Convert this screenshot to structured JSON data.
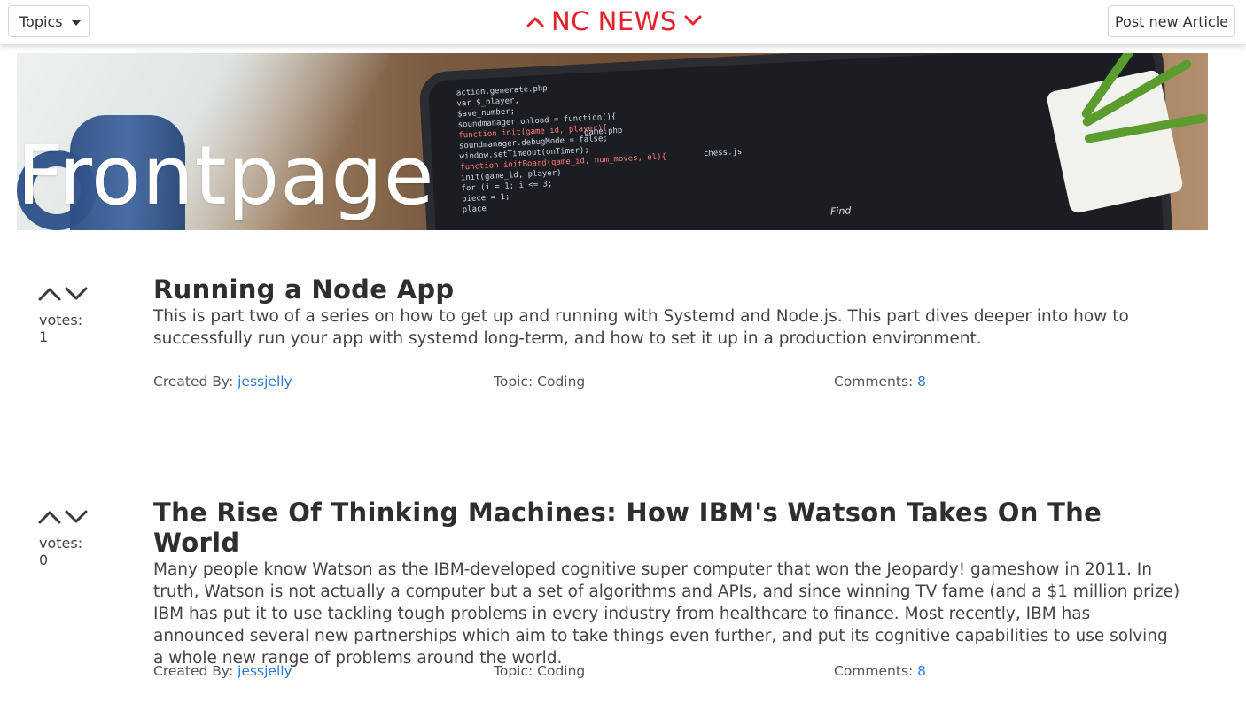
{
  "header": {
    "topics_label": "Topics",
    "brand_title": "NC NEWS",
    "post_label": "Post new Article",
    "brand_color": "#e8202a"
  },
  "hero": {
    "title": "Frontpage",
    "code_lines": [
      "action.generate.php",
      "var $_player,",
      "  $ave_number;",
      "soundmanager.onload = function(){",
      "function init(game_id, player){",
      "  soundmanager.debugMode = false;",
      "  window.setTimeout(onTimer);",
      "function initBoard(game_id, num_moves, el){",
      "  init(game_id, player)",
      "  for (i = 1; i <= 3;",
      "    piece = 1;",
      "place"
    ],
    "tab_labels": [
      "game.php",
      "chess.js"
    ],
    "find_label": "Find"
  },
  "articles": [
    {
      "votes_label": "votes: 1",
      "title": "Running a Node App",
      "body": "This is part two of a series on how to get up and running with Systemd and Node.js. This part dives deeper into how to successfully run your app with systemd long-term, and how to set it up in a production environment.",
      "author_prefix": "Created By: ",
      "author": "jessjelly",
      "topic": "Topic: Coding",
      "comments_prefix": "Comments: ",
      "comments": "8"
    },
    {
      "votes_label": "votes: 0",
      "title": "The Rise Of Thinking Machines: How IBM's Watson Takes On The World",
      "body": "Many people know Watson as the IBM-developed cognitive super computer that won the Jeopardy! gameshow in 2011. In truth, Watson is not actually a computer but a set of algorithms and APIs, and since winning TV fame (and a $1 million prize) IBM has put it to use tackling tough problems in every industry from healthcare to finance. Most recently, IBM has announced several new partnerships which aim to take things even further, and put its cognitive capabilities to use solving a whole new range of problems around the world.",
      "author_prefix": "Created By: ",
      "author": "jessjelly",
      "topic": "Topic: Coding",
      "comments_prefix": "Comments: ",
      "comments": "8"
    }
  ],
  "icons": {
    "upvote": "chevron-up-icon",
    "downvote": "chevron-down-icon",
    "dropdown": "caret-down-icon"
  }
}
